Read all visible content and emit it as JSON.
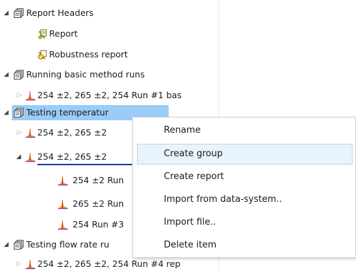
{
  "tree": {
    "items": [
      {
        "label": "Report Headers",
        "icon": "folder-stack-icon",
        "expander": "expanded"
      },
      {
        "label": "Report",
        "icon": "report-icon"
      },
      {
        "label": "Robustness report",
        "icon": "robustness-report-icon"
      },
      {
        "label": "Running basic method runs",
        "icon": "folder-stack-icon",
        "expander": "expanded"
      },
      {
        "label": "254 ±2, 265 ±2, 254 Run #1 bas",
        "icon": "chromatogram-icon",
        "expander": "collapsed"
      },
      {
        "label": "Testing temperatur",
        "icon": "folder-stack-icon",
        "expander": "expanded",
        "selected": true
      },
      {
        "label": "254 ±2, 265 ±2",
        "icon": "chromatogram-icon",
        "expander": "collapsed"
      },
      {
        "label": "254 ±2, 265 ±2",
        "icon": "chromatogram-icon",
        "expander": "expanded"
      },
      {
        "label": "254 ±2 Run",
        "icon": "chromatogram-icon"
      },
      {
        "label": "265 ±2 Run",
        "icon": "chromatogram-icon"
      },
      {
        "label": "254 Run #3",
        "icon": "chromatogram-icon"
      },
      {
        "label": "Testing flow rate ru",
        "icon": "folder-stack-icon",
        "expander": "expanded"
      },
      {
        "label": "254 ±2, 265 ±2, 254 Run #4 rep",
        "icon": "chromatogram-icon",
        "expander": "collapsed"
      }
    ]
  },
  "context_menu": {
    "items": [
      "Rename",
      "Create group",
      "Create report",
      "Import from data-system..",
      "Import file..",
      "Delete item"
    ],
    "hovered": "Create group"
  },
  "glyphs": {
    "expanded": "◢",
    "collapsed": "▷"
  },
  "colors": {
    "selection": "#99ccf7",
    "underline": "#1c2fb0",
    "menu_hover": "#e9f3fc"
  }
}
